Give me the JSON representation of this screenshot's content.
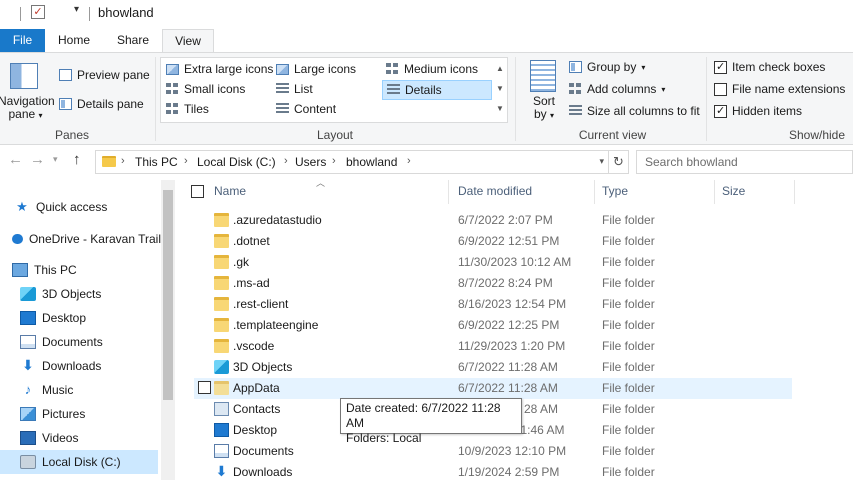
{
  "window": {
    "title": "bhowland"
  },
  "tabs": [
    {
      "label": "File"
    },
    {
      "label": "Home"
    },
    {
      "label": "Share"
    },
    {
      "label": "View"
    }
  ],
  "ribbon": {
    "panes": {
      "navigation_pane_line1": "Navigation",
      "navigation_pane_line2": "pane",
      "preview_pane": "Preview pane",
      "details_pane": "Details pane",
      "group_label": "Panes"
    },
    "layout": {
      "items": [
        "Extra large icons",
        "Large icons",
        "Medium icons",
        "Small icons",
        "List",
        "Details",
        "Tiles",
        "Content"
      ],
      "selected": "Details",
      "group_label": "Layout"
    },
    "current_view": {
      "sort_by_line1": "Sort",
      "sort_by_line2": "by",
      "group_by": "Group by",
      "add_columns": "Add columns",
      "size_all_columns": "Size all columns to fit",
      "group_label": "Current view"
    },
    "show_hide": {
      "item_check_boxes": {
        "label": "Item check boxes",
        "checked": true
      },
      "file_name_extensions": {
        "label": "File name extensions",
        "checked": false
      },
      "hidden_items": {
        "label": "Hidden items",
        "checked": true
      },
      "group_label": "Show/hide"
    }
  },
  "address_bar": {
    "crumbs": [
      "This PC",
      "Local Disk (C:)",
      "Users",
      "bhowland"
    ],
    "search_placeholder": "Search bhowland"
  },
  "sidebar": {
    "items": [
      {
        "label": "Quick access",
        "icon": "star-icon"
      },
      {
        "label": "OneDrive - Karavan Trail",
        "icon": "cloud-icon"
      },
      {
        "label": "This PC",
        "icon": "computer-icon"
      },
      {
        "label": "3D Objects",
        "icon": "cube-icon"
      },
      {
        "label": "Desktop",
        "icon": "desktop-icon"
      },
      {
        "label": "Documents",
        "icon": "documents-icon"
      },
      {
        "label": "Downloads",
        "icon": "downloads-icon"
      },
      {
        "label": "Music",
        "icon": "music-icon"
      },
      {
        "label": "Pictures",
        "icon": "pictures-icon"
      },
      {
        "label": "Videos",
        "icon": "videos-icon"
      },
      {
        "label": "Local Disk (C:)",
        "icon": "disk-icon",
        "selected": true
      }
    ]
  },
  "columns": {
    "name": "Name",
    "date_modified": "Date modified",
    "type": "Type",
    "size": "Size"
  },
  "files": [
    {
      "name": ".azuredatastudio",
      "date": "6/7/2022 2:07 PM",
      "type": "File folder",
      "icon": "folder-icon"
    },
    {
      "name": ".dotnet",
      "date": "6/9/2022 12:51 PM",
      "type": "File folder",
      "icon": "folder-icon"
    },
    {
      "name": ".gk",
      "date": "11/30/2023 10:12 AM",
      "type": "File folder",
      "icon": "folder-icon"
    },
    {
      "name": ".ms-ad",
      "date": "8/7/2022 8:24 PM",
      "type": "File folder",
      "icon": "folder-icon"
    },
    {
      "name": ".rest-client",
      "date": "8/16/2023 12:54 PM",
      "type": "File folder",
      "icon": "folder-icon"
    },
    {
      "name": ".templateengine",
      "date": "6/9/2022 12:25 PM",
      "type": "File folder",
      "icon": "folder-icon"
    },
    {
      "name": ".vscode",
      "date": "11/29/2023 1:20 PM",
      "type": "File folder",
      "icon": "folder-icon"
    },
    {
      "name": "3D Objects",
      "date": "6/7/2022 11:28 AM",
      "type": "File folder",
      "icon": "cube-icon"
    },
    {
      "name": "AppData",
      "date": "6/7/2022 11:28 AM",
      "type": "File folder",
      "icon": "folder-icon",
      "hover": true
    },
    {
      "name": "Contacts",
      "date": "28 AM",
      "type": "File folder",
      "icon": "contacts-icon"
    },
    {
      "name": "Desktop",
      "date": "1/22/2024 11:46 AM",
      "type": "File folder",
      "icon": "desktop-icon"
    },
    {
      "name": "Documents",
      "date": "10/9/2023 12:10 PM",
      "type": "File folder",
      "icon": "documents-icon"
    },
    {
      "name": "Downloads",
      "date": "1/19/2024 2:59 PM",
      "type": "File folder",
      "icon": "downloads-icon"
    }
  ],
  "tooltip": {
    "line1": "Date created: 6/7/2022 11:28 AM",
    "line2": "Folders: Local"
  }
}
